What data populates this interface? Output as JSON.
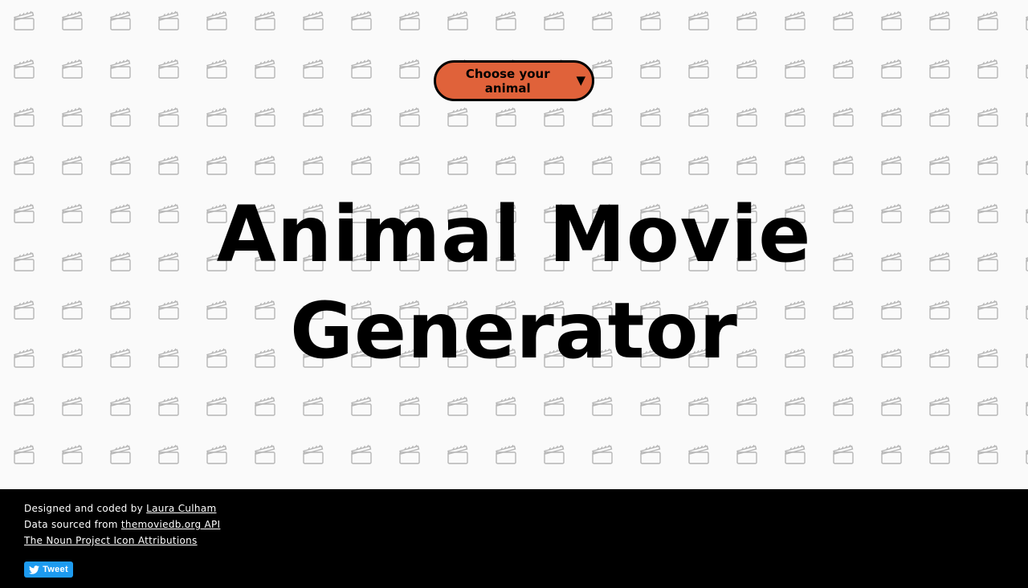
{
  "hero": {
    "dropdown": {
      "label": "Choose your animal",
      "caret": "▼",
      "background": "#e0623a"
    },
    "title": {
      "line1": "Animal Movie",
      "line2": "Generator"
    },
    "background_pattern_icon": "clapperboard-icon"
  },
  "footer": {
    "credit_prefix": "Designed and coded by",
    "credit_author": "Laura Culham",
    "data_prefix": "Data sourced from",
    "data_link": "themoviedb.org API",
    "attributions_link": "The Noun Project Icon Attributions",
    "tweet_label": "Tweet",
    "tweet_icon": "twitter-bird-icon",
    "tweet_color": "#1d9bf0"
  }
}
